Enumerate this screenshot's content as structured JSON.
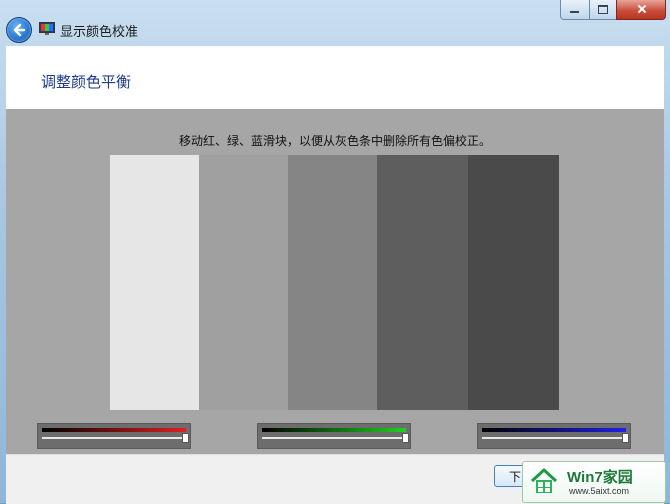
{
  "window": {
    "title": "显示颜色校准"
  },
  "page": {
    "heading": "调整颜色平衡",
    "instruction": "移动红、绿、蓝滑块，以便从灰色条中删除所有色偏校正。"
  },
  "calibration": {
    "bars": [
      "#e6e6e6",
      "#a0a0a0",
      "#858585",
      "#5e5e5e",
      "#4a4a4a"
    ],
    "sliders": [
      {
        "channel": "red",
        "gradient_end": "#e02020",
        "value_fraction": 0.99
      },
      {
        "channel": "green",
        "gradient_end": "#20d020",
        "value_fraction": 0.99
      },
      {
        "channel": "blue",
        "gradient_end": "#2020e8",
        "value_fraction": 0.99
      }
    ]
  },
  "footer": {
    "next_label": "下"
  },
  "watermark": {
    "brand": "Win7家园",
    "url": "www.5aixt.com"
  }
}
